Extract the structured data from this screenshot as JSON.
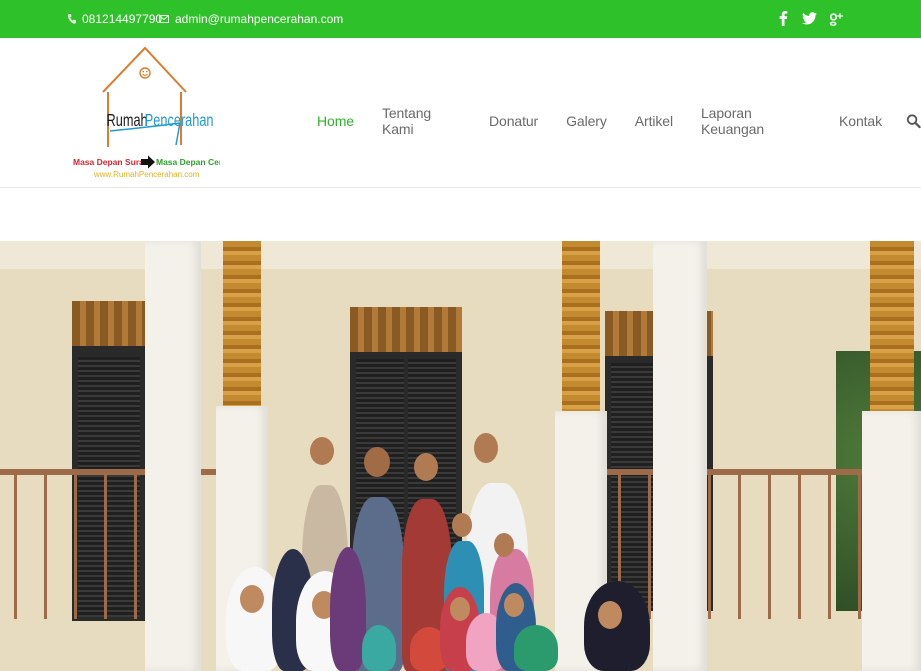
{
  "topbar": {
    "phone": "081214497790",
    "email": "admin@rumahpencerahan.com",
    "social": [
      {
        "name": "facebook",
        "glyph": "f"
      },
      {
        "name": "twitter",
        "glyph": "t"
      },
      {
        "name": "google-plus",
        "glyph": "g+"
      }
    ],
    "color": "#2fc12a"
  },
  "logo": {
    "name": "Rumah Pencerahan",
    "tagline_left": "Masa Depan Suram",
    "tagline_right": "Masa Depan Cerah",
    "url": "www.RumahPencerahan.com"
  },
  "nav": {
    "items": [
      {
        "label": "Home",
        "active": true
      },
      {
        "label": "Tentang Kami",
        "active": false
      },
      {
        "label": "Donatur",
        "active": false
      },
      {
        "label": "Galery",
        "active": false
      },
      {
        "label": "Artikel",
        "active": false
      },
      {
        "label": "Laporan Keuangan",
        "active": false
      },
      {
        "label": "Kontak",
        "active": false
      }
    ],
    "accent": "#2fb52a",
    "search_icon": "search-icon"
  }
}
